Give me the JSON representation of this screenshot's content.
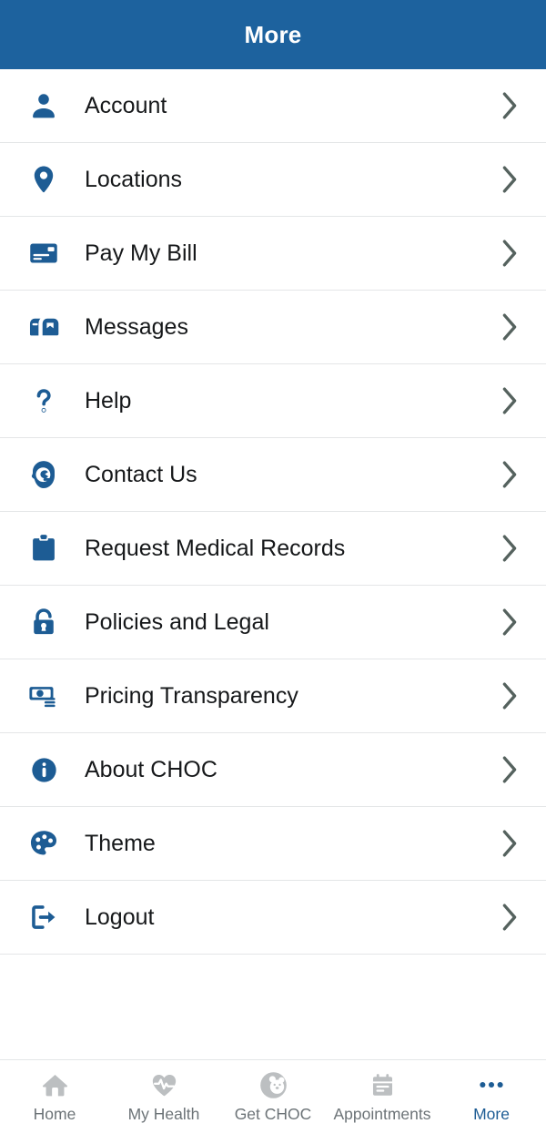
{
  "header": {
    "title": "More",
    "background_color": "#1d629e",
    "text_color": "#ffffff"
  },
  "theme": {
    "icon_blue": "#1d5c94",
    "chevron_gray": "#55625e",
    "divider": "#e4e6e7",
    "text_dark": "#16181a",
    "nav_inactive": "#bcbfc1",
    "nav_label_inactive": "#6c7377",
    "nav_active": "#1d5c94"
  },
  "menu": {
    "items": [
      {
        "label": "Account",
        "icon": "person-icon",
        "chevron": "chevron-right-icon"
      },
      {
        "label": "Locations",
        "icon": "map-pin-icon",
        "chevron": "chevron-right-icon"
      },
      {
        "label": "Pay My Bill",
        "icon": "credit-card-icon",
        "chevron": "chevron-right-icon"
      },
      {
        "label": "Messages",
        "icon": "mailbox-icon",
        "chevron": "chevron-right-icon"
      },
      {
        "label": "Help",
        "icon": "question-mark-icon",
        "chevron": "chevron-right-icon"
      },
      {
        "label": "Contact Us",
        "icon": "headset-face-icon",
        "chevron": "chevron-right-icon"
      },
      {
        "label": "Request Medical Records",
        "icon": "clipboard-icon",
        "chevron": "chevron-right-icon"
      },
      {
        "label": "Policies and Legal",
        "icon": "padlock-icon",
        "chevron": "chevron-right-icon"
      },
      {
        "label": "Pricing Transparency",
        "icon": "money-icon",
        "chevron": "chevron-right-icon"
      },
      {
        "label": "About CHOC",
        "icon": "info-circle-icon",
        "chevron": "chevron-right-icon"
      },
      {
        "label": "Theme",
        "icon": "palette-icon",
        "chevron": "chevron-right-icon"
      },
      {
        "label": "Logout",
        "icon": "logout-arrow-icon",
        "chevron": "chevron-right-icon"
      }
    ]
  },
  "bottom_nav": {
    "items": [
      {
        "label": "Home",
        "icon": "home-icon",
        "active": false
      },
      {
        "label": "My Health",
        "icon": "heart-pulse-icon",
        "active": false
      },
      {
        "label": "Get CHOC",
        "icon": "bear-face-icon",
        "active": false
      },
      {
        "label": "Appointments",
        "icon": "calendar-icon",
        "active": false
      },
      {
        "label": "More",
        "icon": "ellipsis-icon",
        "active": true
      }
    ]
  }
}
